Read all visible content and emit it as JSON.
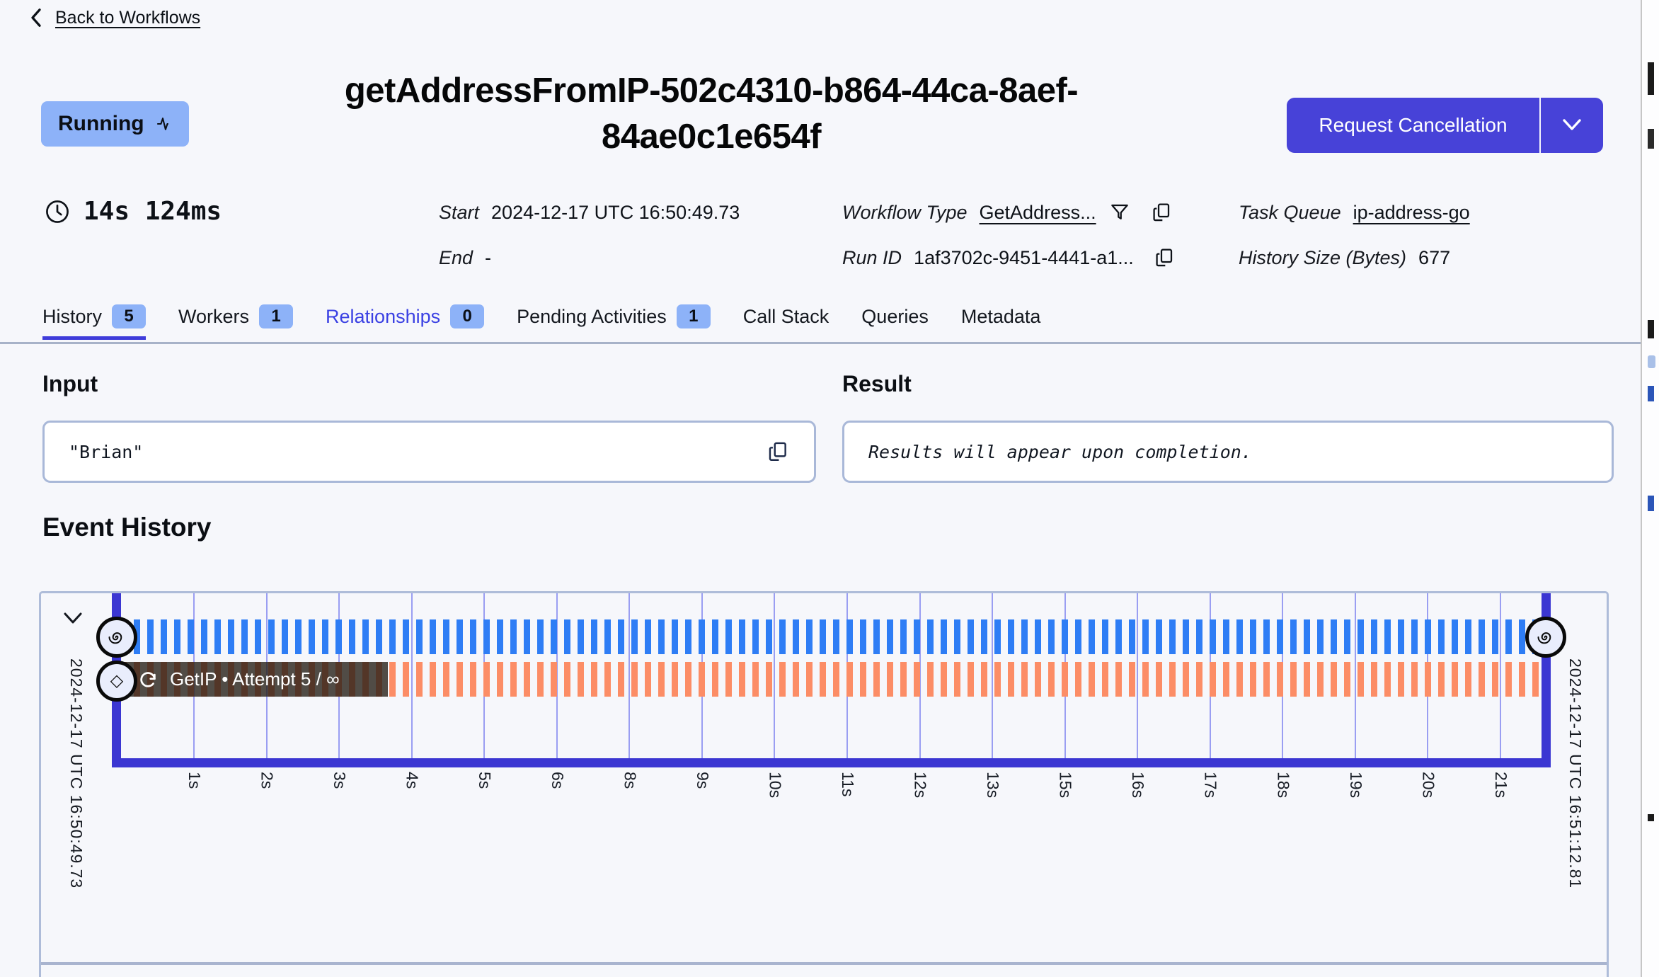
{
  "header": {
    "back_link": "Back to Workflows",
    "status_badge": "Running",
    "title_line1": "getAddressFromIP-502c4310-b864-44ca-8aef-",
    "title_line2": "84ae0c1e654f",
    "cancel_button": "Request Cancellation"
  },
  "summary": {
    "duration": "14s 124ms",
    "start_label": "Start",
    "start_value": "2024-12-17 UTC 16:50:49.73",
    "end_label": "End",
    "end_value": "-",
    "workflow_type_label": "Workflow Type",
    "workflow_type_value": "GetAddress...",
    "run_id_label": "Run ID",
    "run_id_value": "1af3702c-9451-4441-a1...",
    "task_queue_label": "Task Queue",
    "task_queue_value": "ip-address-go",
    "history_size_label": "History Size (Bytes)",
    "history_size_value": "677"
  },
  "tabs": [
    {
      "label": "History",
      "count": "5",
      "state": "active"
    },
    {
      "label": "Workers",
      "count": "1",
      "state": "normal"
    },
    {
      "label": "Relationships",
      "count": "0",
      "state": "highlight"
    },
    {
      "label": "Pending Activities",
      "count": "1",
      "state": "normal"
    },
    {
      "label": "Call Stack",
      "count": "",
      "state": "normal"
    },
    {
      "label": "Queries",
      "count": "",
      "state": "normal"
    },
    {
      "label": "Metadata",
      "count": "",
      "state": "normal"
    }
  ],
  "io": {
    "input_heading": "Input",
    "input_value": "\"Brian\"",
    "result_heading": "Result",
    "result_placeholder": "Results will appear upon completion."
  },
  "event_history": {
    "heading": "Event History",
    "start_timestamp": "2024-12-17 UTC 16:50:49.73",
    "end_timestamp": "2024-12-17 UTC 16:51:12.81",
    "activity_label": "GetIP • Attempt 5 / ∞",
    "ticks": [
      "1s",
      "2s",
      "3s",
      "4s",
      "5s",
      "6s",
      "8s",
      "9s",
      "10s",
      "11s",
      "12s",
      "13s",
      "15s",
      "16s",
      "17s",
      "18s",
      "19s",
      "20s",
      "21s"
    ]
  },
  "colors": {
    "accent": "#4742d8",
    "status_badge_bg": "#8db2f8",
    "timeline_blue": "#2e7df5",
    "timeline_orange": "#fc8d66",
    "timeline_frame": "#3b36d2",
    "highlight_tab_text": "#3b41e3"
  }
}
